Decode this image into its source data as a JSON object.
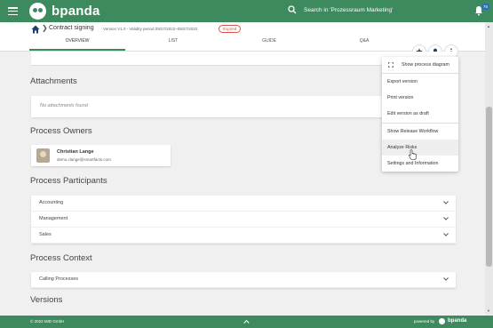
{
  "header": {
    "app_name": "bpanda",
    "search_placeholder": "Search in 'Prozessraum Marketing'",
    "notification_count": "76"
  },
  "breadcrumb": {
    "title": "Contract signing",
    "meta": "Version V1.0 - Validity period 09/27/2022–09/27/2022",
    "status": "Expired"
  },
  "tabs": [
    {
      "label": "OVERVIEW"
    },
    {
      "label": "LIST"
    },
    {
      "label": "GUIDE"
    },
    {
      "label": "Q&A"
    }
  ],
  "sections": {
    "attachments": "Attachments",
    "attachments_empty": "No attachments found",
    "owners": "Process Owners",
    "participants": "Process Participants",
    "context": "Process Context",
    "versions": "Versions"
  },
  "owner": {
    "name": "Christian Lange",
    "email": "demo.clange@smartfacts.com"
  },
  "participants": [
    {
      "label": "Accounting"
    },
    {
      "label": "Management"
    },
    {
      "label": "Sales"
    }
  ],
  "context_rows": [
    {
      "label": "Calling Processes"
    }
  ],
  "menu": {
    "items": [
      {
        "label": "Show process diagram"
      },
      {
        "label": "Export version"
      },
      {
        "label": "Print version"
      },
      {
        "label": "Edit version as draft"
      },
      {
        "label": "Show Release Workflow"
      },
      {
        "label": "Analyze Risks"
      },
      {
        "label": "Settings and Information"
      }
    ]
  },
  "footer": {
    "copyright": "© 2022 MID GmbH",
    "powered_by": "powered by",
    "brand": "bpanda"
  },
  "colors": {
    "brand_green": "#3d8a5e",
    "expired_red": "#d9534f",
    "badge_blue": "#2a6fb7"
  }
}
